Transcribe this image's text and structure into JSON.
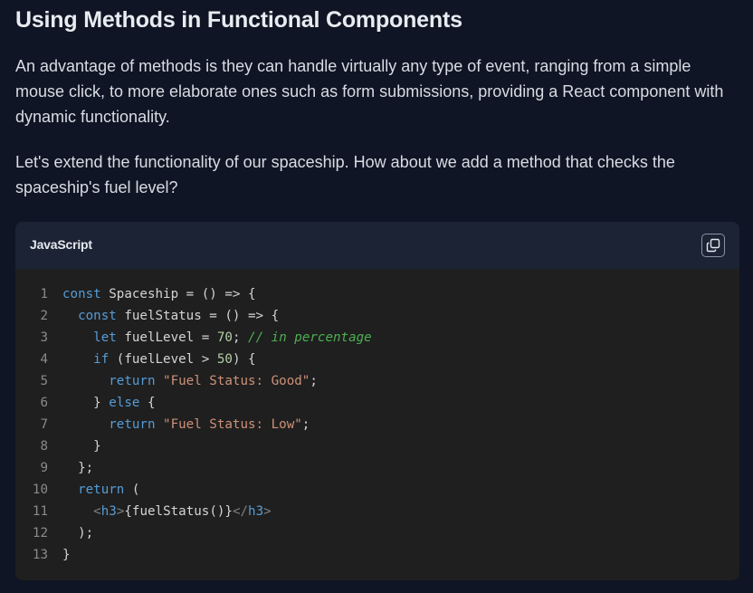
{
  "article": {
    "title": "Using Methods in Functional Components",
    "paragraph1": "An advantage of methods is they can handle virtually any type of event, ranging from a simple mouse click, to more elaborate ones such as form submissions, providing a React component with dynamic functionality.",
    "paragraph2": "Let's extend the functionality of our spaceship. How about we add a method that checks the spaceship's fuel level?"
  },
  "code_block": {
    "language": "JavaScript",
    "copy_icon": "copy-icon",
    "lines": [
      {
        "num": "1",
        "parts": [
          [
            "kw",
            "const"
          ],
          [
            "plain",
            " Spaceship = () => {"
          ]
        ]
      },
      {
        "num": "2",
        "parts": [
          [
            "plain",
            "  "
          ],
          [
            "kw",
            "const"
          ],
          [
            "plain",
            " fuelStatus = () => {"
          ]
        ]
      },
      {
        "num": "3",
        "parts": [
          [
            "plain",
            "    "
          ],
          [
            "kw",
            "let"
          ],
          [
            "plain",
            " fuelLevel = "
          ],
          [
            "num",
            "70"
          ],
          [
            "plain",
            "; "
          ],
          [
            "cmt",
            "// in percentage"
          ]
        ]
      },
      {
        "num": "4",
        "parts": [
          [
            "plain",
            "    "
          ],
          [
            "kw",
            "if"
          ],
          [
            "plain",
            " (fuelLevel > "
          ],
          [
            "num",
            "50"
          ],
          [
            "plain",
            ") {"
          ]
        ]
      },
      {
        "num": "5",
        "parts": [
          [
            "plain",
            "      "
          ],
          [
            "kw",
            "return"
          ],
          [
            "plain",
            " "
          ],
          [
            "str",
            "\"Fuel Status: Good\""
          ],
          [
            "plain",
            ";"
          ]
        ]
      },
      {
        "num": "6",
        "parts": [
          [
            "plain",
            "    } "
          ],
          [
            "kw",
            "else"
          ],
          [
            "plain",
            " {"
          ]
        ]
      },
      {
        "num": "7",
        "parts": [
          [
            "plain",
            "      "
          ],
          [
            "kw",
            "return"
          ],
          [
            "plain",
            " "
          ],
          [
            "str",
            "\"Fuel Status: Low\""
          ],
          [
            "plain",
            ";"
          ]
        ]
      },
      {
        "num": "8",
        "parts": [
          [
            "plain",
            "    }"
          ]
        ]
      },
      {
        "num": "9",
        "parts": [
          [
            "plain",
            "  };"
          ]
        ]
      },
      {
        "num": "10",
        "parts": [
          [
            "plain",
            "  "
          ],
          [
            "kw",
            "return"
          ],
          [
            "plain",
            " ("
          ]
        ]
      },
      {
        "num": "11",
        "parts": [
          [
            "plain",
            "    "
          ],
          [
            "tag",
            "<"
          ],
          [
            "tagname",
            "h3"
          ],
          [
            "tag",
            ">"
          ],
          [
            "plain",
            "{fuelStatus()}"
          ],
          [
            "tag",
            "</"
          ],
          [
            "tagname",
            "h3"
          ],
          [
            "tag",
            ">"
          ]
        ]
      },
      {
        "num": "12",
        "parts": [
          [
            "plain",
            "  );"
          ]
        ]
      },
      {
        "num": "13",
        "parts": [
          [
            "plain",
            "}"
          ]
        ]
      }
    ]
  },
  "colors": {
    "page_background": "#0f1524",
    "code_header_background": "#1b2335",
    "code_background": "#1f1f1f",
    "keyword": "#569cd6",
    "string": "#ce9178",
    "number": "#b5cea8",
    "comment": "#4caf50"
  }
}
